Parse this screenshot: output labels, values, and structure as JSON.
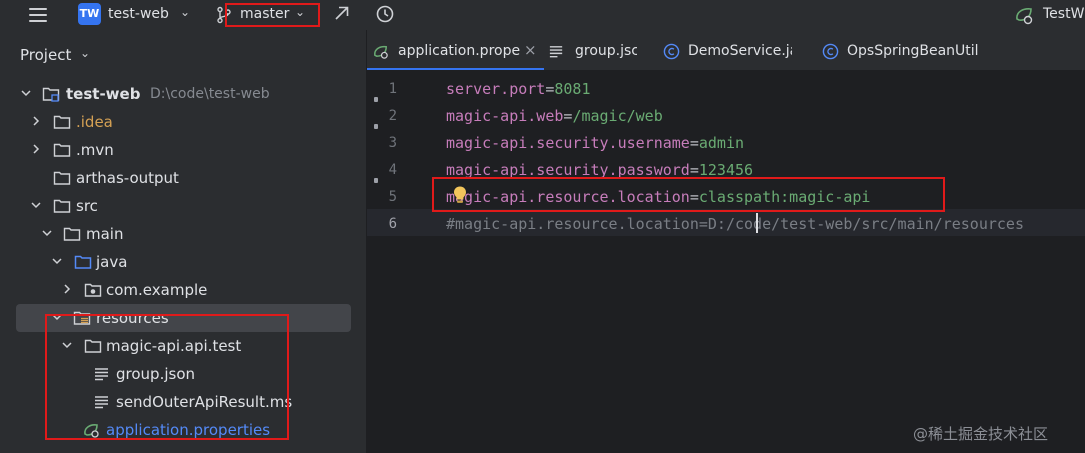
{
  "toolbar": {
    "project_badge": "TW",
    "project_name": "test-web",
    "branch": "master",
    "run_config": "TestW"
  },
  "project_panel": {
    "title": "Project",
    "tree": [
      {
        "label": "test-web",
        "path": "D:\\code\\test-web",
        "icon": "module-folder-icon",
        "expanded": true
      },
      {
        "label": ".idea",
        "icon": "folder-icon",
        "expanded": false,
        "color": "#d5a154"
      },
      {
        "label": ".mvn",
        "icon": "folder-icon",
        "expanded": false
      },
      {
        "label": "arthas-output",
        "icon": "folder-icon"
      },
      {
        "label": "src",
        "icon": "folder-icon",
        "expanded": true
      },
      {
        "label": "main",
        "icon": "folder-icon",
        "expanded": true
      },
      {
        "label": "java",
        "icon": "source-folder-icon",
        "expanded": true
      },
      {
        "label": "com.example",
        "icon": "package-icon",
        "expanded": false
      },
      {
        "label": "resources",
        "icon": "resources-folder-icon",
        "expanded": true,
        "selected": true
      },
      {
        "label": "magic-api.api.test",
        "icon": "folder-icon",
        "expanded": true
      },
      {
        "label": "group.json",
        "icon": "text-file-icon"
      },
      {
        "label": "sendOuterApiResult.ms",
        "icon": "text-file-icon"
      },
      {
        "label": "application.properties",
        "icon": "spring-properties-icon",
        "color": "#548af7"
      }
    ]
  },
  "editor": {
    "tabs": [
      {
        "label": "application.prope",
        "icon": "spring-properties-icon",
        "active": true,
        "closable": true
      },
      {
        "label": "group.jsc",
        "icon": "text-file-icon"
      },
      {
        "label": "DemoService.ja",
        "icon": "class-icon"
      },
      {
        "label": "OpsSpringBeanUtil",
        "icon": "class-icon"
      }
    ],
    "lines": [
      {
        "num": "1",
        "key": "server.port",
        "eq": "=",
        "value": "8081"
      },
      {
        "num": "2",
        "key": "magic-api.web",
        "eq": "=",
        "value": "/magic/web"
      },
      {
        "num": "3",
        "key": "magic-api.security.username",
        "eq": "=",
        "value": "admin"
      },
      {
        "num": "4",
        "key": "magic-api.security.password",
        "eq": "=",
        "value": "123456"
      },
      {
        "num": "5",
        "key": "magic-api.resource.location",
        "eq": "=",
        "value": "classpath:magic-api"
      },
      {
        "num": "6",
        "comment": "#magic-api.resource.location=D:/code/test-web/src/main/resources"
      }
    ],
    "current_line": "6"
  },
  "watermark": "@稀土掘金技术社区",
  "colors": {
    "accent": "#3574f0",
    "highlight_box": "#e01a1a",
    "property_key": "#c77dbb",
    "property_value": "#6aab73",
    "comment": "#7a7e85"
  }
}
